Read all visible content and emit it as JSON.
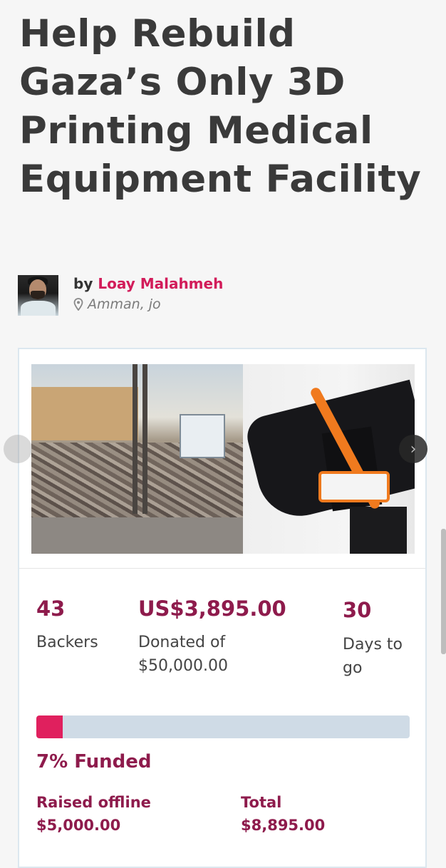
{
  "campaign": {
    "title": "Help Rebuild Gaza’s Only 3D Printing Medical Equipment Facility"
  },
  "author": {
    "by_label": "by",
    "name": "Loay Malahmeh",
    "location": "Amman, jo",
    "avatar_icon": "user-photo",
    "location_icon": "map-pin-icon"
  },
  "gallery": {
    "next_icon": "chevron-right-icon",
    "prev_icon": "chevron-left-icon"
  },
  "stats": {
    "backers": {
      "value": "43",
      "label": "Backers"
    },
    "donated": {
      "value": "US$3,895.00",
      "label": "Donated of $50,000.00"
    },
    "days": {
      "value": "30",
      "label": "Days to go"
    }
  },
  "progress": {
    "percent": 7,
    "funded_label": "7% Funded"
  },
  "offline": {
    "raised_label": "Raised offline",
    "raised_value": "$5,000.00",
    "total_label": "Total",
    "total_value": "$8,895.00"
  },
  "colors": {
    "accent": "#d21c5a",
    "stat_text": "#8e1b4c",
    "progress_fill": "#e0205e",
    "progress_track": "#cfdbe6"
  }
}
